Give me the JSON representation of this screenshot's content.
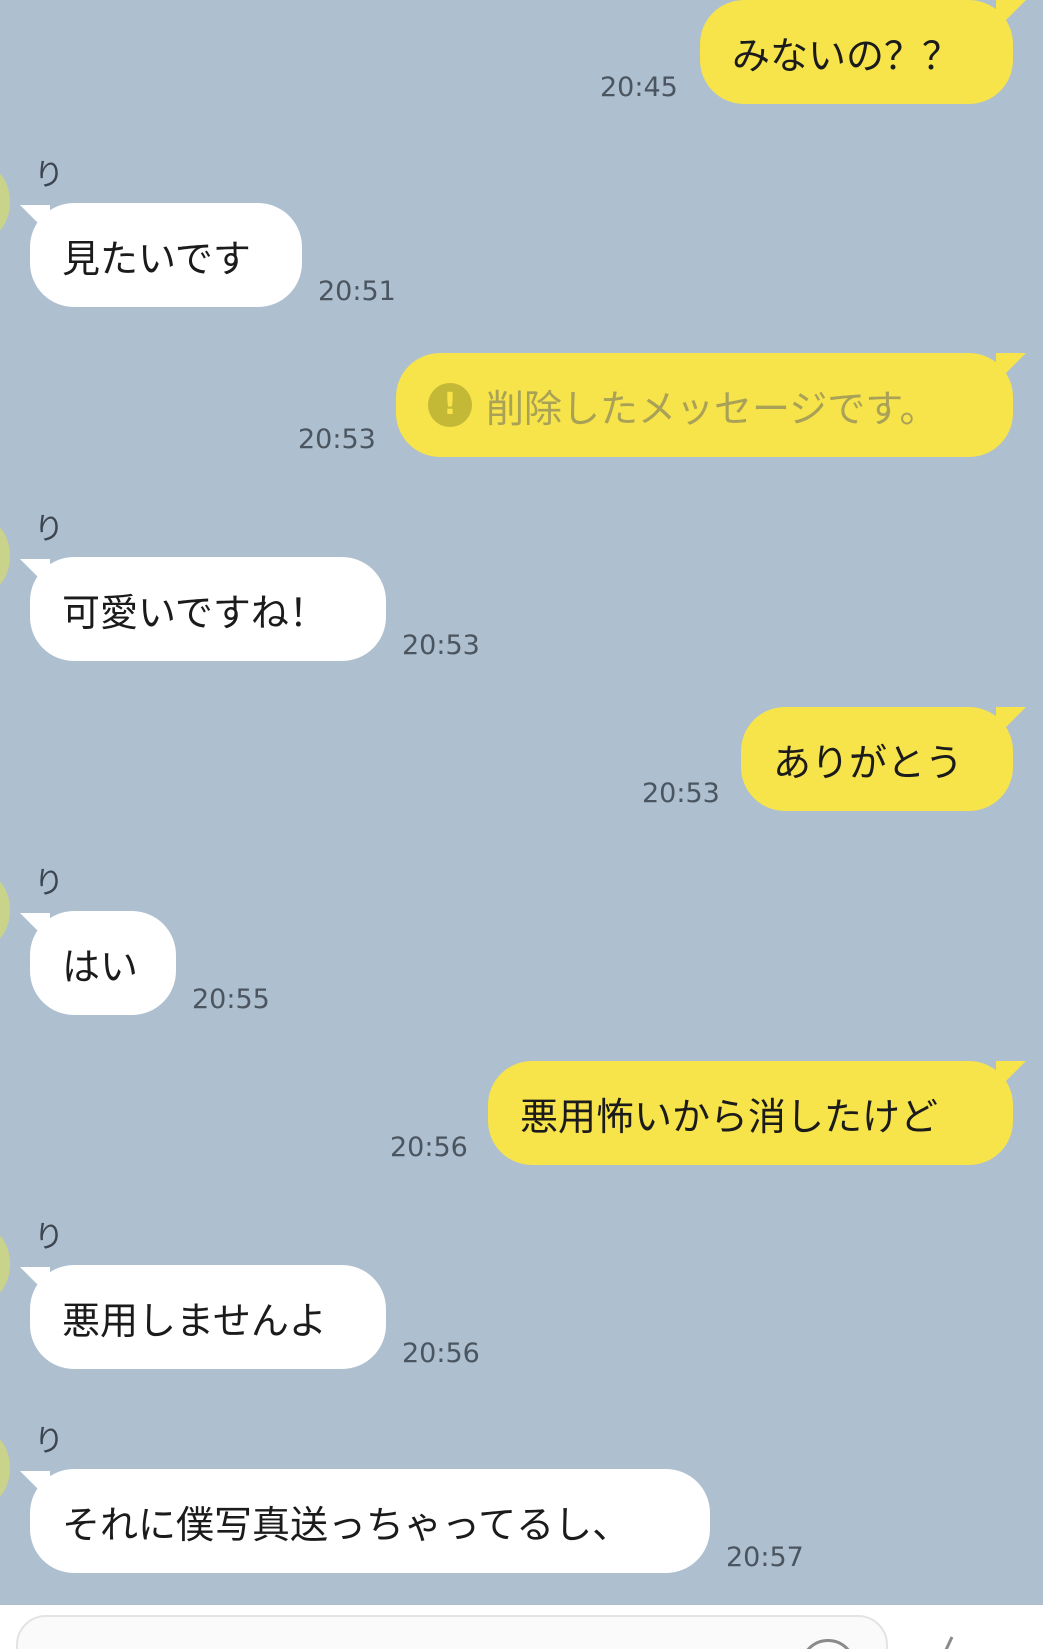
{
  "messages": [
    {
      "side": "right",
      "text": "みないの？？",
      "time": "20:45"
    },
    {
      "side": "left",
      "sender": "り",
      "text": "見たいです",
      "time": "20:51"
    },
    {
      "side": "right",
      "text": "削除したメッセージです。",
      "time": "20:53",
      "deleted": true
    },
    {
      "side": "left",
      "sender": "り",
      "text": "可愛いですね！",
      "time": "20:53"
    },
    {
      "side": "right",
      "text": "ありがとう",
      "time": "20:53"
    },
    {
      "side": "left",
      "sender": "り",
      "text": "はい",
      "time": "20:55"
    },
    {
      "side": "right",
      "text": "悪用怖いから消したけど",
      "time": "20:56"
    },
    {
      "side": "left",
      "sender": "り",
      "text": "悪用しませんよ",
      "time": "20:56"
    },
    {
      "side": "left",
      "sender": "り",
      "text": "それに僕写真送っちゃってるし、",
      "time": "20:57"
    }
  ],
  "deleted_icon_glyph": "!",
  "colors": {
    "background": "#aebfcf",
    "mine_bubble": "#f7e34a",
    "their_bubble": "#ffffff",
    "time_text": "#4b5560"
  },
  "icons": [
    "warning-icon",
    "emoji-icon",
    "mic-icon"
  ]
}
